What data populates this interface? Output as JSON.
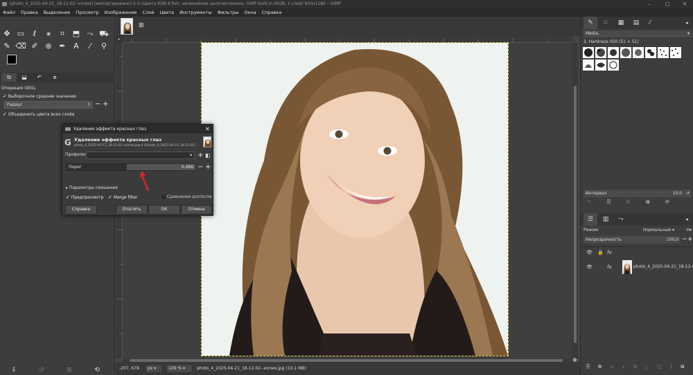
{
  "window": {
    "title": "[photo_4_2025-04-21_18-12-02--копия] (импортировано)-2.0 (Цвета RGB 8 бит, нелинейное целочисленное, GIMP built-in sRGB, 1 слой) 850x1280 – GIMP",
    "minimize": "–",
    "maximize": "▢",
    "close": "✕"
  },
  "menu": [
    "Файл",
    "Правка",
    "Выделение",
    "Просмотр",
    "Изображение",
    "Слой",
    "Цвета",
    "Инструменты",
    "Фильтры",
    "Окна",
    "Справка"
  ],
  "tool_options": {
    "heading": "Операция GEGL",
    "option1": "Выборочное среднее значение",
    "radius_label": "Радиус",
    "radius_value": "3",
    "merge_label": "Объединить цвета всех слоёв"
  },
  "dialog": {
    "title": "Удаление эффекта красных глаз",
    "header": "Удаление эффекта красных глаз",
    "subheader": "photo_4_2025-04-21_18-12-02--копия.jpg-4 ([photo_4_2025-04-21_18-12-02-...",
    "profiles_label": "Профили:",
    "threshold_label": "Порог",
    "threshold_value": "0,466",
    "threshold_fraction": 0.466,
    "blend_label": "Параметры смешения",
    "preview_label": "Предпросмотр",
    "merge_filter_label": "Merge filter",
    "compare_label": "Сравнение до/после",
    "help_button": "Справка",
    "reset_button": "Отатить",
    "ok_button": "ОК",
    "cancel_button": "Отмена"
  },
  "status": {
    "coords": "-207, 678",
    "unit": "px",
    "zoom": "100 %",
    "file": "photo_4_2025-04-21_18-12-02--копия.jpg (10,1 MB)"
  },
  "brushes": {
    "category": "Media,",
    "current": "2. Hardness 050 (51 × 51)"
  },
  "spacing": {
    "label": "Интервал",
    "value": "10,0"
  },
  "layers": {
    "mode_label": "Режим",
    "mode_value": "Нормальный",
    "opacity_label": "Непрозрачность",
    "opacity_value": "100,0",
    "layer_name": "photo_4_2025-04-21_18-12-0",
    "fx": "fx"
  },
  "colors": {
    "accent_arrow": "#d9262c"
  }
}
